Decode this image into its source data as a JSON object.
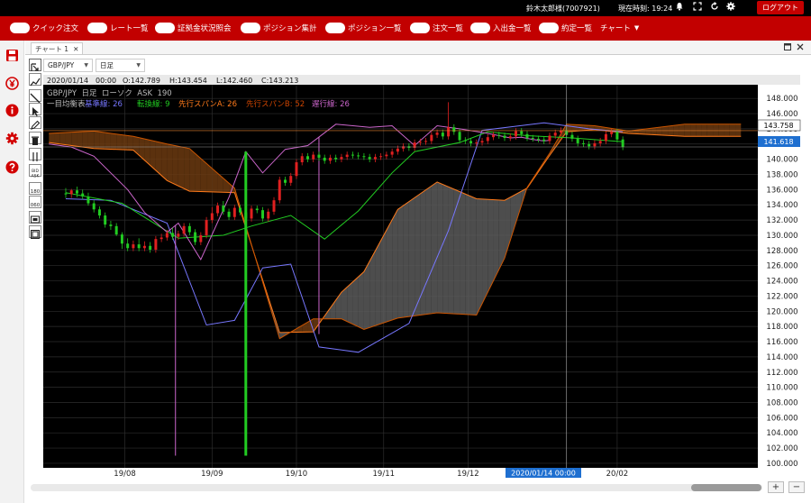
{
  "topbar": {
    "user": "鈴木太郎様(7007921)",
    "time": "現在時刻: 19:24",
    "logout": "ログアウト"
  },
  "menu": [
    {
      "label": "クイック注文"
    },
    {
      "label": "レート一覧"
    },
    {
      "label": "証拠金状況照会"
    },
    {
      "label": "ポジション集計"
    },
    {
      "label": "ポジション一覧"
    },
    {
      "label": "注文一覧"
    },
    {
      "label": "入出金一覧"
    },
    {
      "label": "約定一覧"
    },
    {
      "label": "チャート"
    }
  ],
  "tab": {
    "label": "チャート 1",
    "close": "✕"
  },
  "selectors": {
    "pair": "GBP/JPY",
    "period": "日足"
  },
  "colors": {
    "brand_red": "#c20000",
    "chart_bg": "#000000",
    "candle_up": "#e02020",
    "candle_down": "#22cc22",
    "kijun": "#7777ff",
    "tenkan": "#22cc22",
    "span_a": "#ff7a1a",
    "span_b": "#cc5500",
    "chikou": "#cc66cc",
    "current_price_label": "#1e6fd0"
  },
  "chart_info": {
    "ohlc_date": "2020/01/14",
    "ohlc_time": "00:00",
    "open": "O:142.789",
    "high": "H:143.454",
    "low": "L:142.460",
    "close": "C:143.213",
    "header_line": "GBP/JPY  日足  ローソク  ASK  190",
    "indicator_name": "一目均衡表",
    "kijun_label": "基準線: 26",
    "tenkan_label": "転換線: 9",
    "span_a_label": "先行スパンA: 26",
    "span_b_label": "先行スパンB: 52",
    "chikou_label": "遅行線: 26"
  },
  "price_labels": {
    "crosshair_price": "143.758",
    "current_price": "141.618",
    "crosshair_date": "2020/01/14 00:00"
  },
  "chart_data": {
    "type": "candlestick",
    "y_ticks": [
      "148.000",
      "146.000",
      "144.000",
      "142.000",
      "140.000",
      "138.000",
      "136.000",
      "134.000",
      "132.000",
      "130.000",
      "128.000",
      "126.000",
      "124.000",
      "122.000",
      "120.000",
      "118.000",
      "116.000",
      "114.000",
      "112.000",
      "110.000",
      "108.000",
      "106.000",
      "104.000",
      "102.000",
      "100.000"
    ],
    "ylim": [
      99.4,
      149.8
    ],
    "x_labels": [
      "19/08",
      "19/09",
      "19/10",
      "19/11",
      "19/12",
      "20/02"
    ],
    "x_label_days": [
      21,
      52,
      82,
      113,
      143,
      196
    ],
    "crosshair_day": 178,
    "xlim": [
      -8,
      246
    ],
    "candles": [
      [
        0,
        135.5,
        135.4,
        136.2,
        134.9
      ],
      [
        2,
        135.4,
        135.9,
        136.1,
        134.9
      ],
      [
        4,
        135.9,
        135.5,
        136.4,
        135.0
      ],
      [
        6,
        135.5,
        135.1,
        136.0,
        134.7
      ],
      [
        8,
        135.1,
        134.2,
        135.6,
        133.9
      ],
      [
        10,
        134.2,
        133.4,
        134.6,
        133.0
      ],
      [
        12,
        133.4,
        132.6,
        133.8,
        132.2
      ],
      [
        14,
        132.6,
        131.4,
        133.0,
        131.0
      ],
      [
        16,
        131.4,
        131.2,
        131.9,
        130.7
      ],
      [
        18,
        131.2,
        130.1,
        131.6,
        129.9
      ],
      [
        20,
        130.1,
        128.9,
        130.4,
        128.2
      ],
      [
        22,
        128.9,
        128.3,
        129.6,
        127.9
      ],
      [
        24,
        128.3,
        128.8,
        129.3,
        127.9
      ],
      [
        26,
        128.8,
        128.3,
        129.6,
        127.9
      ],
      [
        28,
        128.3,
        128.6,
        129.2,
        127.9
      ],
      [
        30,
        128.6,
        128.1,
        129.1,
        127.7
      ],
      [
        32,
        128.1,
        129.5,
        129.9,
        127.7
      ],
      [
        34,
        129.5,
        129.7,
        130.2,
        129.1
      ],
      [
        36,
        129.7,
        130.3,
        130.7,
        129.3
      ],
      [
        38,
        130.3,
        129.8,
        131.0,
        129.4
      ],
      [
        40,
        129.8,
        130.2,
        130.6,
        129.4
      ],
      [
        42,
        130.2,
        131.2,
        131.6,
        129.8
      ],
      [
        44,
        131.2,
        130.4,
        131.6,
        130.0
      ],
      [
        46,
        130.4,
        129.1,
        130.8,
        128.7
      ],
      [
        48,
        129.1,
        130.0,
        130.4,
        128.7
      ],
      [
        50,
        130.0,
        132.0,
        132.4,
        129.6
      ],
      [
        52,
        132.0,
        132.9,
        133.7,
        131.6
      ],
      [
        54,
        132.9,
        133.9,
        134.3,
        132.5
      ],
      [
        56,
        133.9,
        133.1,
        134.5,
        132.7
      ],
      [
        58,
        133.1,
        132.4,
        133.5,
        132.0
      ],
      [
        60,
        132.4,
        133.6,
        134.0,
        132.0
      ],
      [
        62,
        133.6,
        133.0,
        134.0,
        132.6
      ],
      [
        64,
        133.0,
        132.2,
        133.4,
        131.8
      ],
      [
        66,
        132.2,
        133.5,
        133.9,
        131.8
      ],
      [
        68,
        133.5,
        133.3,
        133.9,
        132.9
      ],
      [
        70,
        133.3,
        132.2,
        133.7,
        131.8
      ],
      [
        72,
        132.2,
        133.1,
        133.5,
        131.8
      ],
      [
        74,
        133.1,
        134.6,
        135.0,
        132.7
      ],
      [
        76,
        134.6,
        137.3,
        137.7,
        134.2
      ],
      [
        78,
        137.3,
        136.9,
        137.7,
        136.5
      ],
      [
        80,
        136.9,
        137.8,
        138.2,
        136.5
      ],
      [
        82,
        137.8,
        139.6,
        140.0,
        137.4
      ],
      [
        84,
        139.6,
        140.4,
        140.8,
        139.2
      ],
      [
        86,
        140.4,
        140.0,
        140.8,
        139.6
      ],
      [
        88,
        140.0,
        140.6,
        141.0,
        139.6
      ],
      [
        90,
        140.6,
        140.2,
        141.0,
        139.8
      ],
      [
        92,
        140.2,
        139.8,
        140.6,
        139.4
      ],
      [
        94,
        139.8,
        140.2,
        140.6,
        139.4
      ],
      [
        96,
        140.2,
        140.0,
        140.6,
        139.6
      ],
      [
        98,
        140.0,
        140.3,
        140.7,
        139.6
      ],
      [
        100,
        140.3,
        140.6,
        141.0,
        139.9
      ],
      [
        102,
        140.6,
        140.5,
        141.0,
        140.1
      ],
      [
        104,
        140.5,
        140.4,
        140.9,
        140.0
      ],
      [
        106,
        140.4,
        140.3,
        140.8,
        139.9
      ],
      [
        108,
        140.3,
        140.0,
        140.7,
        139.6
      ],
      [
        110,
        140.0,
        140.3,
        140.7,
        139.6
      ],
      [
        112,
        140.3,
        140.4,
        140.8,
        139.9
      ],
      [
        114,
        140.4,
        140.6,
        141.0,
        140.0
      ],
      [
        116,
        140.6,
        141.0,
        141.4,
        140.2
      ],
      [
        118,
        141.0,
        141.4,
        141.8,
        140.6
      ],
      [
        120,
        141.4,
        141.7,
        142.1,
        141.0
      ],
      [
        122,
        141.7,
        141.5,
        142.1,
        141.1
      ],
      [
        124,
        141.5,
        142.2,
        142.6,
        141.1
      ],
      [
        126,
        142.2,
        142.3,
        142.7,
        141.8
      ],
      [
        128,
        142.3,
        142.4,
        142.8,
        141.9
      ],
      [
        130,
        142.4,
        143.2,
        143.6,
        142.0
      ],
      [
        132,
        143.2,
        143.5,
        143.9,
        142.8
      ],
      [
        134,
        143.5,
        143.0,
        143.9,
        142.6
      ],
      [
        136,
        143.0,
        144.2,
        147.5,
        142.6
      ],
      [
        138,
        144.2,
        143.6,
        144.6,
        143.2
      ],
      [
        140,
        143.6,
        142.5,
        144.0,
        142.1
      ],
      [
        142,
        142.5,
        142.4,
        142.9,
        142.0
      ],
      [
        144,
        142.4,
        142.1,
        142.8,
        141.7
      ],
      [
        146,
        142.1,
        142.2,
        142.6,
        141.7
      ],
      [
        148,
        142.2,
        142.4,
        142.8,
        141.8
      ],
      [
        150,
        142.4,
        142.9,
        143.3,
        142.0
      ],
      [
        152,
        142.9,
        143.2,
        143.6,
        142.5
      ],
      [
        154,
        143.2,
        143.1,
        143.6,
        142.7
      ],
      [
        156,
        143.1,
        142.8,
        143.5,
        142.4
      ],
      [
        158,
        142.8,
        143.0,
        143.4,
        142.4
      ],
      [
        160,
        143.0,
        143.7,
        144.1,
        142.6
      ],
      [
        162,
        143.7,
        143.3,
        144.1,
        142.9
      ],
      [
        164,
        143.3,
        142.8,
        143.7,
        142.4
      ],
      [
        166,
        142.8,
        142.7,
        143.2,
        142.3
      ],
      [
        168,
        142.7,
        142.6,
        143.1,
        142.2
      ],
      [
        170,
        142.6,
        142.4,
        143.0,
        142.0
      ],
      [
        172,
        142.4,
        143.1,
        143.5,
        142.0
      ],
      [
        174,
        143.1,
        143.5,
        143.9,
        142.7
      ],
      [
        176,
        143.5,
        143.8,
        144.2,
        143.1
      ],
      [
        178,
        143.8,
        143.2,
        144.2,
        142.8
      ],
      [
        180,
        143.2,
        142.7,
        143.6,
        142.3
      ],
      [
        182,
        142.7,
        142.1,
        143.1,
        141.7
      ],
      [
        184,
        142.1,
        142.0,
        142.5,
        141.6
      ],
      [
        186,
        142.0,
        141.7,
        142.4,
        141.3
      ],
      [
        188,
        141.7,
        142.1,
        142.5,
        141.3
      ],
      [
        190,
        142.1,
        142.4,
        142.8,
        141.7
      ],
      [
        192,
        142.4,
        143.3,
        143.7,
        142.0
      ],
      [
        194,
        143.3,
        143.6,
        144.0,
        142.9
      ],
      [
        196,
        143.6,
        142.6,
        144.0,
        142.2
      ],
      [
        198,
        142.6,
        141.6,
        143.0,
        141.2
      ]
    ],
    "spike_down": [
      [
        39,
        101.0
      ],
      [
        64,
        101.0
      ],
      [
        90,
        117.0
      ]
    ],
    "tenkan": [
      [
        0,
        135.6
      ],
      [
        20,
        134.2
      ],
      [
        40,
        129.6
      ],
      [
        56,
        130.0
      ],
      [
        66,
        131.2
      ],
      [
        80,
        132.6
      ],
      [
        92,
        129.5
      ],
      [
        104,
        133.2
      ],
      [
        116,
        138.2
      ],
      [
        124,
        141.0
      ],
      [
        140,
        142.2
      ],
      [
        150,
        143.6
      ],
      [
        164,
        143.1
      ],
      [
        180,
        142.8
      ],
      [
        198,
        142.3
      ]
    ],
    "kijun": [
      [
        0,
        134.8
      ],
      [
        16,
        134.6
      ],
      [
        36,
        131.6
      ],
      [
        50,
        118.2
      ],
      [
        60,
        118.8
      ],
      [
        70,
        125.7
      ],
      [
        80,
        126.2
      ],
      [
        90,
        115.3
      ],
      [
        104,
        114.6
      ],
      [
        122,
        118.4
      ],
      [
        136,
        130.6
      ],
      [
        148,
        143.8
      ],
      [
        170,
        144.8
      ],
      [
        186,
        144.0
      ],
      [
        198,
        143.6
      ]
    ],
    "chikou": [
      [
        -6,
        142.0
      ],
      [
        2,
        141.6
      ],
      [
        10,
        140.4
      ],
      [
        16,
        138.2
      ],
      [
        22,
        136.0
      ],
      [
        28,
        133.0
      ],
      [
        36,
        130.4
      ],
      [
        40,
        131.6
      ],
      [
        48,
        126.8
      ],
      [
        58,
        135.0
      ],
      [
        64,
        141.0
      ],
      [
        70,
        138.2
      ],
      [
        78,
        141.3
      ],
      [
        86,
        141.8
      ],
      [
        96,
        144.6
      ],
      [
        108,
        144.2
      ],
      [
        116,
        144.4
      ],
      [
        124,
        141.8
      ],
      [
        132,
        144.4
      ],
      [
        140,
        144.0
      ],
      [
        150,
        143.4
      ],
      [
        158,
        142.8
      ],
      [
        162,
        142.9
      ],
      [
        166,
        142.6
      ],
      [
        170,
        142.4
      ],
      [
        172,
        142.5
      ]
    ],
    "span_a": [
      [
        -6,
        142.2
      ],
      [
        10,
        141.4
      ],
      [
        24,
        141.2
      ],
      [
        36,
        137.2
      ],
      [
        44,
        135.8
      ],
      [
        60,
        135.6
      ],
      [
        76,
        117.2
      ],
      [
        88,
        117.3
      ],
      [
        98,
        122.5
      ],
      [
        106,
        125.2
      ],
      [
        118,
        133.4
      ],
      [
        132,
        137.0
      ],
      [
        146,
        134.8
      ],
      [
        156,
        134.6
      ],
      [
        164,
        136.2
      ],
      [
        172,
        140.5
      ],
      [
        178,
        143.6
      ],
      [
        188,
        143.9
      ],
      [
        200,
        143.4
      ],
      [
        220,
        143.0
      ],
      [
        240,
        143.0
      ]
    ],
    "span_b": [
      [
        -6,
        143.4
      ],
      [
        10,
        143.7
      ],
      [
        24,
        143.0
      ],
      [
        36,
        142.0
      ],
      [
        44,
        141.4
      ],
      [
        60,
        136.2
      ],
      [
        76,
        116.4
      ],
      [
        88,
        119.0
      ],
      [
        98,
        119.0
      ],
      [
        106,
        117.6
      ],
      [
        118,
        119.1
      ],
      [
        132,
        119.8
      ],
      [
        146,
        119.5
      ],
      [
        156,
        127.0
      ],
      [
        164,
        136.3
      ],
      [
        172,
        140.8
      ],
      [
        178,
        144.6
      ],
      [
        188,
        144.4
      ],
      [
        200,
        143.7
      ],
      [
        220,
        144.6
      ],
      [
        240,
        144.6
      ]
    ]
  }
}
